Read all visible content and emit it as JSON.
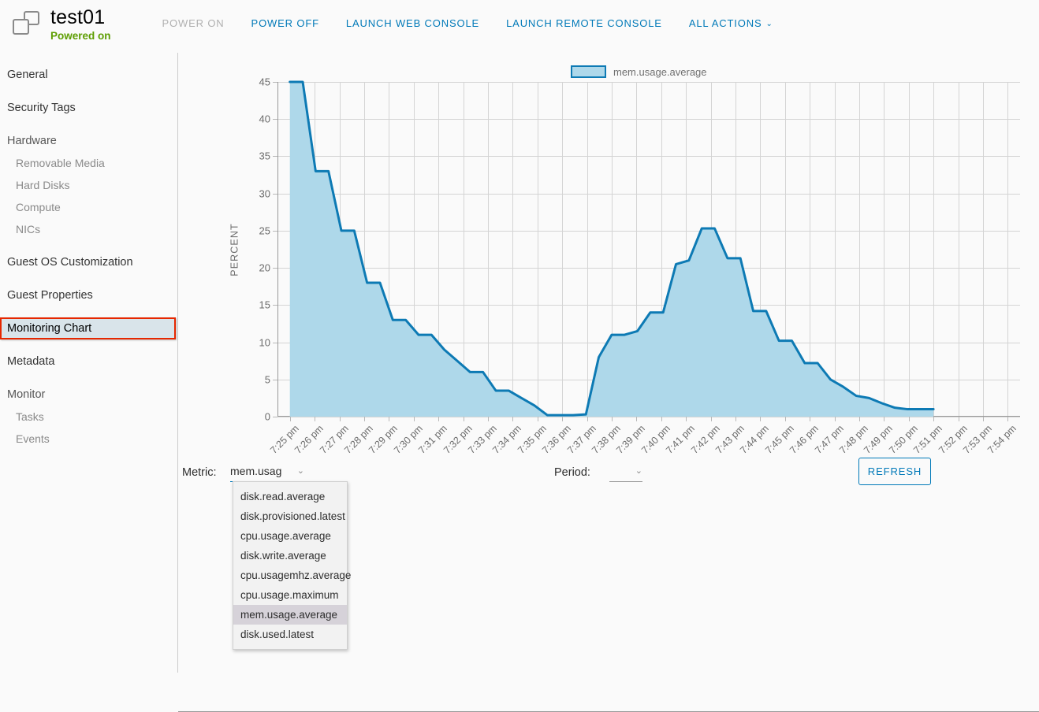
{
  "header": {
    "icon": "vm-icon",
    "title": "test01",
    "status": "Powered on",
    "status_color": "#5c9d00",
    "actions": [
      {
        "label": "POWER ON",
        "disabled": true
      },
      {
        "label": "POWER OFF",
        "disabled": false
      },
      {
        "label": "LAUNCH WEB CONSOLE",
        "disabled": false
      },
      {
        "label": "LAUNCH REMOTE CONSOLE",
        "disabled": false
      },
      {
        "label": "ALL ACTIONS",
        "disabled": false,
        "caret": "⌄"
      }
    ]
  },
  "sidebar": {
    "items": [
      {
        "label": "General",
        "level": "top",
        "selected": false
      },
      {
        "label": "Security Tags",
        "level": "top",
        "selected": false
      },
      {
        "label": "Hardware",
        "level": "group",
        "selected": false
      },
      {
        "label": "Removable Media",
        "level": "sub",
        "selected": false
      },
      {
        "label": "Hard Disks",
        "level": "sub",
        "selected": false
      },
      {
        "label": "Compute",
        "level": "sub",
        "selected": false
      },
      {
        "label": "NICs",
        "level": "sub",
        "selected": false
      },
      {
        "label": "Guest OS Customization",
        "level": "top",
        "selected": false
      },
      {
        "label": "Guest Properties",
        "level": "top",
        "selected": false
      },
      {
        "label": "Monitoring Chart",
        "level": "top",
        "selected": true
      },
      {
        "label": "Metadata",
        "level": "top",
        "selected": false
      },
      {
        "label": "Monitor",
        "level": "group",
        "selected": false
      },
      {
        "label": "Tasks",
        "level": "sub",
        "selected": false
      },
      {
        "label": "Events",
        "level": "sub",
        "selected": false
      }
    ]
  },
  "controls": {
    "metric_label": "Metric:",
    "metric_value": "mem.usag",
    "period_label": "Period:",
    "period_value": "",
    "caret_glyph": "⌄",
    "refresh_label": "REFRESH",
    "metric_options": [
      {
        "label": "disk.read.average",
        "selected": false
      },
      {
        "label": "disk.provisioned.latest",
        "selected": false
      },
      {
        "label": "cpu.usage.average",
        "selected": false
      },
      {
        "label": "disk.write.average",
        "selected": false
      },
      {
        "label": "cpu.usagemhz.average",
        "selected": false
      },
      {
        "label": "cpu.usage.maximum",
        "selected": false
      },
      {
        "label": "mem.usage.average",
        "selected": true
      },
      {
        "label": "disk.used.latest",
        "selected": false
      }
    ]
  },
  "chart_data": {
    "type": "area",
    "title": "",
    "xlabel": "",
    "ylabel": "PERCENT",
    "ylim": [
      0,
      45
    ],
    "yticks": [
      0,
      5,
      10,
      15,
      20,
      25,
      30,
      35,
      40,
      45
    ],
    "grid": true,
    "legend_position": "top",
    "line_color": "#0d7ab4",
    "fill_color": "#aed8ea",
    "series": [
      {
        "name": "mem.usage.average",
        "values": [
          45,
          45,
          33,
          33,
          25,
          25,
          18,
          18,
          13,
          13,
          11,
          11,
          9,
          7.5,
          6,
          6,
          3.5,
          3.5,
          2.5,
          1.5,
          0.2,
          0.2,
          0.2,
          0.3,
          8,
          11,
          11,
          11.5,
          14,
          14,
          20.5,
          21,
          25.3,
          25.3,
          21.3,
          21.3,
          14.2,
          14.2,
          10.2,
          10.2,
          7.2,
          7.2,
          5,
          4,
          2.8,
          2.5,
          1.8,
          1.2,
          1,
          1,
          1
        ]
      }
    ],
    "categories": [
      "7:25 pm",
      "7:26 pm",
      "7:27 pm",
      "7:28 pm",
      "7:29 pm",
      "7:30 pm",
      "7:31 pm",
      "7:32 pm",
      "7:33 pm",
      "7:34 pm",
      "7:35 pm",
      "7:36 pm",
      "7:37 pm",
      "7:38 pm",
      "7:39 pm",
      "7:40 pm",
      "7:41 pm",
      "7:42 pm",
      "7:43 pm",
      "7:44 pm",
      "7:45 pm",
      "7:46 pm",
      "7:47 pm",
      "7:48 pm",
      "7:49 pm",
      "7:50 pm",
      "7:51 pm",
      "7:52 pm",
      "7:53 pm",
      "7:54 pm"
    ],
    "data_start_category": "7:25 pm",
    "data_end_category": "7:51 pm",
    "legend": [
      {
        "label": "mem.usage.average",
        "color": "#aed8ea",
        "border": "#0d7ab4"
      }
    ]
  }
}
